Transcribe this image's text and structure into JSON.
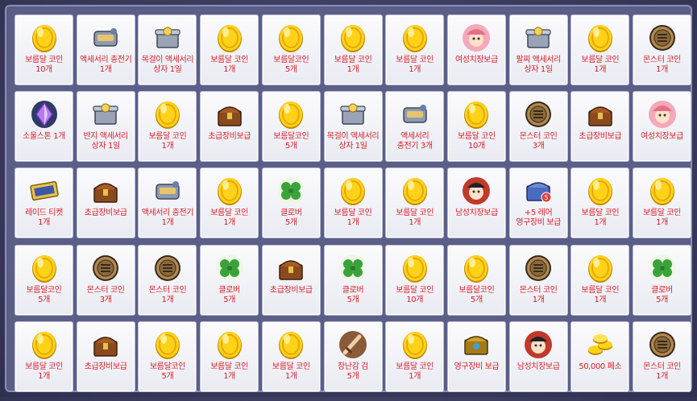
{
  "reward_board": {
    "rows": [
      [
        {
          "icon": "gold-coin-icon",
          "label": "보름달 코인\n10개"
        },
        {
          "icon": "accessory-charger-icon",
          "label": "액세서리 충전기\n1개"
        },
        {
          "icon": "accessory-box-icon",
          "label": "목걸이 액세서리\n상자 1일"
        },
        {
          "icon": "gold-coin-icon",
          "label": "보름달 코인\n1개"
        },
        {
          "icon": "gold-coin-icon",
          "label": "보름달코인\n5개"
        },
        {
          "icon": "gold-coin-icon",
          "label": "보름달 코인\n1개"
        },
        {
          "icon": "gold-coin-icon",
          "label": "보름달 코인\n1개"
        },
        {
          "icon": "female-costume-icon",
          "label": "여성치장보급"
        },
        {
          "icon": "accessory-box-icon",
          "label": "팔찌 액세서리\n상자 1일"
        },
        {
          "icon": "gold-coin-icon",
          "label": "보름달 코인\n1개"
        },
        {
          "icon": "monster-coin-icon",
          "label": "몬스터 코인\n1개"
        }
      ],
      [
        {
          "icon": "soul-stone-icon",
          "label": "소울스톤 1개"
        },
        {
          "icon": "accessory-box-icon",
          "label": "반지 액세서리\n상자 1일"
        },
        {
          "icon": "gold-coin-icon",
          "label": "보름달 코인\n1개"
        },
        {
          "icon": "treasure-chest-icon",
          "label": "초급장비보급"
        },
        {
          "icon": "gold-coin-icon",
          "label": "보름달코인\n5개"
        },
        {
          "icon": "accessory-box-icon",
          "label": "목걸이 액세서리\n상자 1일"
        },
        {
          "icon": "accessory-charger-icon",
          "label": "액세서리\n충전기 3개"
        },
        {
          "icon": "gold-coin-icon",
          "label": "보름달 코인\n10개"
        },
        {
          "icon": "monster-coin-icon",
          "label": "몬스터 코인\n3개"
        },
        {
          "icon": "treasure-chest-icon",
          "label": "초급장비보급"
        },
        {
          "icon": "female-costume-icon",
          "label": "여성치장보급"
        }
      ],
      [
        {
          "icon": "raid-ticket-icon",
          "label": "레이드 티켓\n1개"
        },
        {
          "icon": "treasure-chest-icon",
          "label": "초급장비보급"
        },
        {
          "icon": "accessory-charger-icon",
          "label": "액세서리 충전기\n1개"
        },
        {
          "icon": "gold-coin-icon",
          "label": "보름달 코인\n1개"
        },
        {
          "icon": "clover-icon",
          "label": "클로버\n5개"
        },
        {
          "icon": "gold-coin-icon",
          "label": "보름달 코인\n1개"
        },
        {
          "icon": "gold-coin-icon",
          "label": "보름달 코인\n1개"
        },
        {
          "icon": "male-costume-icon",
          "label": "남성치장보급"
        },
        {
          "icon": "rare-equipment-box-icon",
          "label": "+5 레어\n영구장비 보급"
        },
        {
          "icon": "gold-coin-icon",
          "label": "보름달 코인\n1개"
        },
        {
          "icon": "gold-coin-icon",
          "label": "보름달 코인\n1개"
        }
      ],
      [
        {
          "icon": "gold-coin-icon",
          "label": "보름달코인\n5개"
        },
        {
          "icon": "monster-coin-icon",
          "label": "몬스터 코인\n3개"
        },
        {
          "icon": "monster-coin-icon",
          "label": "몬스터 코인\n1개"
        },
        {
          "icon": "clover-icon",
          "label": "클로버\n5개"
        },
        {
          "icon": "treasure-chest-icon",
          "label": "초급장비보급"
        },
        {
          "icon": "clover-icon",
          "label": "클로버\n5개"
        },
        {
          "icon": "gold-coin-icon",
          "label": "보름달 코인\n10개"
        },
        {
          "icon": "gold-coin-icon",
          "label": "보름달코인\n5개"
        },
        {
          "icon": "monster-coin-icon",
          "label": "몬스터 코인\n1개"
        },
        {
          "icon": "gold-coin-icon",
          "label": "보름달 코인\n1개"
        },
        {
          "icon": "clover-icon",
          "label": "클로버\n5개"
        }
      ],
      [
        {
          "icon": "gold-coin-icon",
          "label": "보름달 코인\n1개"
        },
        {
          "icon": "treasure-chest-icon",
          "label": "초급장비보급"
        },
        {
          "icon": "gold-coin-icon",
          "label": "보름달코인\n5개"
        },
        {
          "icon": "gold-coin-icon",
          "label": "보름달 코인\n1개"
        },
        {
          "icon": "gold-coin-icon",
          "label": "보름달 코인\n1개"
        },
        {
          "icon": "prank-sword-icon",
          "label": "장난감 검\n5개"
        },
        {
          "icon": "gold-coin-icon",
          "label": "보름달 코인\n1개"
        },
        {
          "icon": "permanent-equipment-icon",
          "label": "영구장비 보급"
        },
        {
          "icon": "male-costume-icon",
          "label": "남성치장보급"
        },
        {
          "icon": "peso-coins-icon",
          "label": "50,000 페소"
        },
        {
          "icon": "monster-coin-icon",
          "label": "몬스터 코인\n1개"
        }
      ]
    ]
  }
}
